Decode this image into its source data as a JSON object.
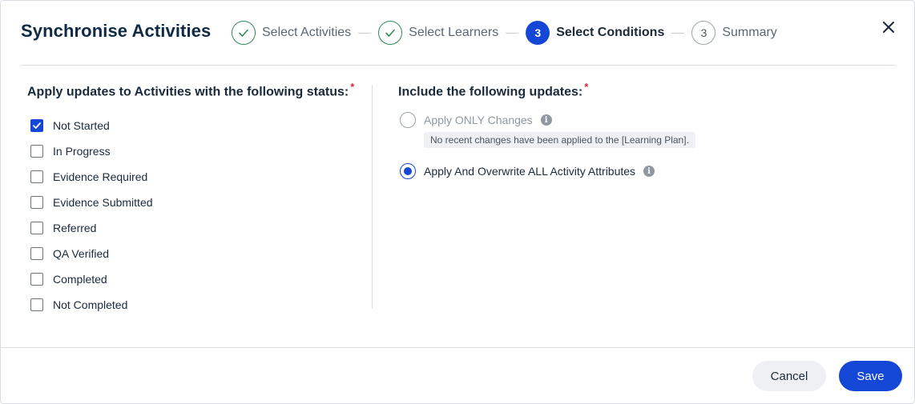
{
  "dialog": {
    "title": "Synchronise Activities",
    "close_icon": "close-icon"
  },
  "stepper": {
    "steps": [
      {
        "label": "Select Activities",
        "state": "done",
        "marker": ""
      },
      {
        "label": "Select Learners",
        "state": "done",
        "marker": ""
      },
      {
        "label": "Select Conditions",
        "state": "active",
        "marker": "3"
      },
      {
        "label": "Summary",
        "state": "pending",
        "marker": "3"
      }
    ]
  },
  "status_section": {
    "heading": "Apply updates to Activities with the following status:",
    "required_mark": "*",
    "options": [
      {
        "label": "Not Started",
        "checked": true
      },
      {
        "label": "In Progress",
        "checked": false
      },
      {
        "label": "Evidence Required",
        "checked": false
      },
      {
        "label": "Evidence Submitted",
        "checked": false
      },
      {
        "label": "Referred",
        "checked": false
      },
      {
        "label": "QA Verified",
        "checked": false
      },
      {
        "label": "Completed",
        "checked": false
      },
      {
        "label": "Not Completed",
        "checked": false
      }
    ]
  },
  "updates_section": {
    "heading": "Include the following updates:",
    "required_mark": "*",
    "options": [
      {
        "label": "Apply ONLY Changes",
        "selected": false,
        "disabled": true,
        "info": "i"
      },
      {
        "label": "Apply And Overwrite ALL Activity Attributes",
        "selected": true,
        "disabled": false,
        "info": "i"
      }
    ],
    "note": "No recent changes have been applied to the [Learning Plan]."
  },
  "footer": {
    "cancel_label": "Cancel",
    "save_label": "Save"
  },
  "colors": {
    "primary": "#1447d6",
    "success": "#2e8b57",
    "required": "#d6263b",
    "title": "#0f2a44"
  }
}
